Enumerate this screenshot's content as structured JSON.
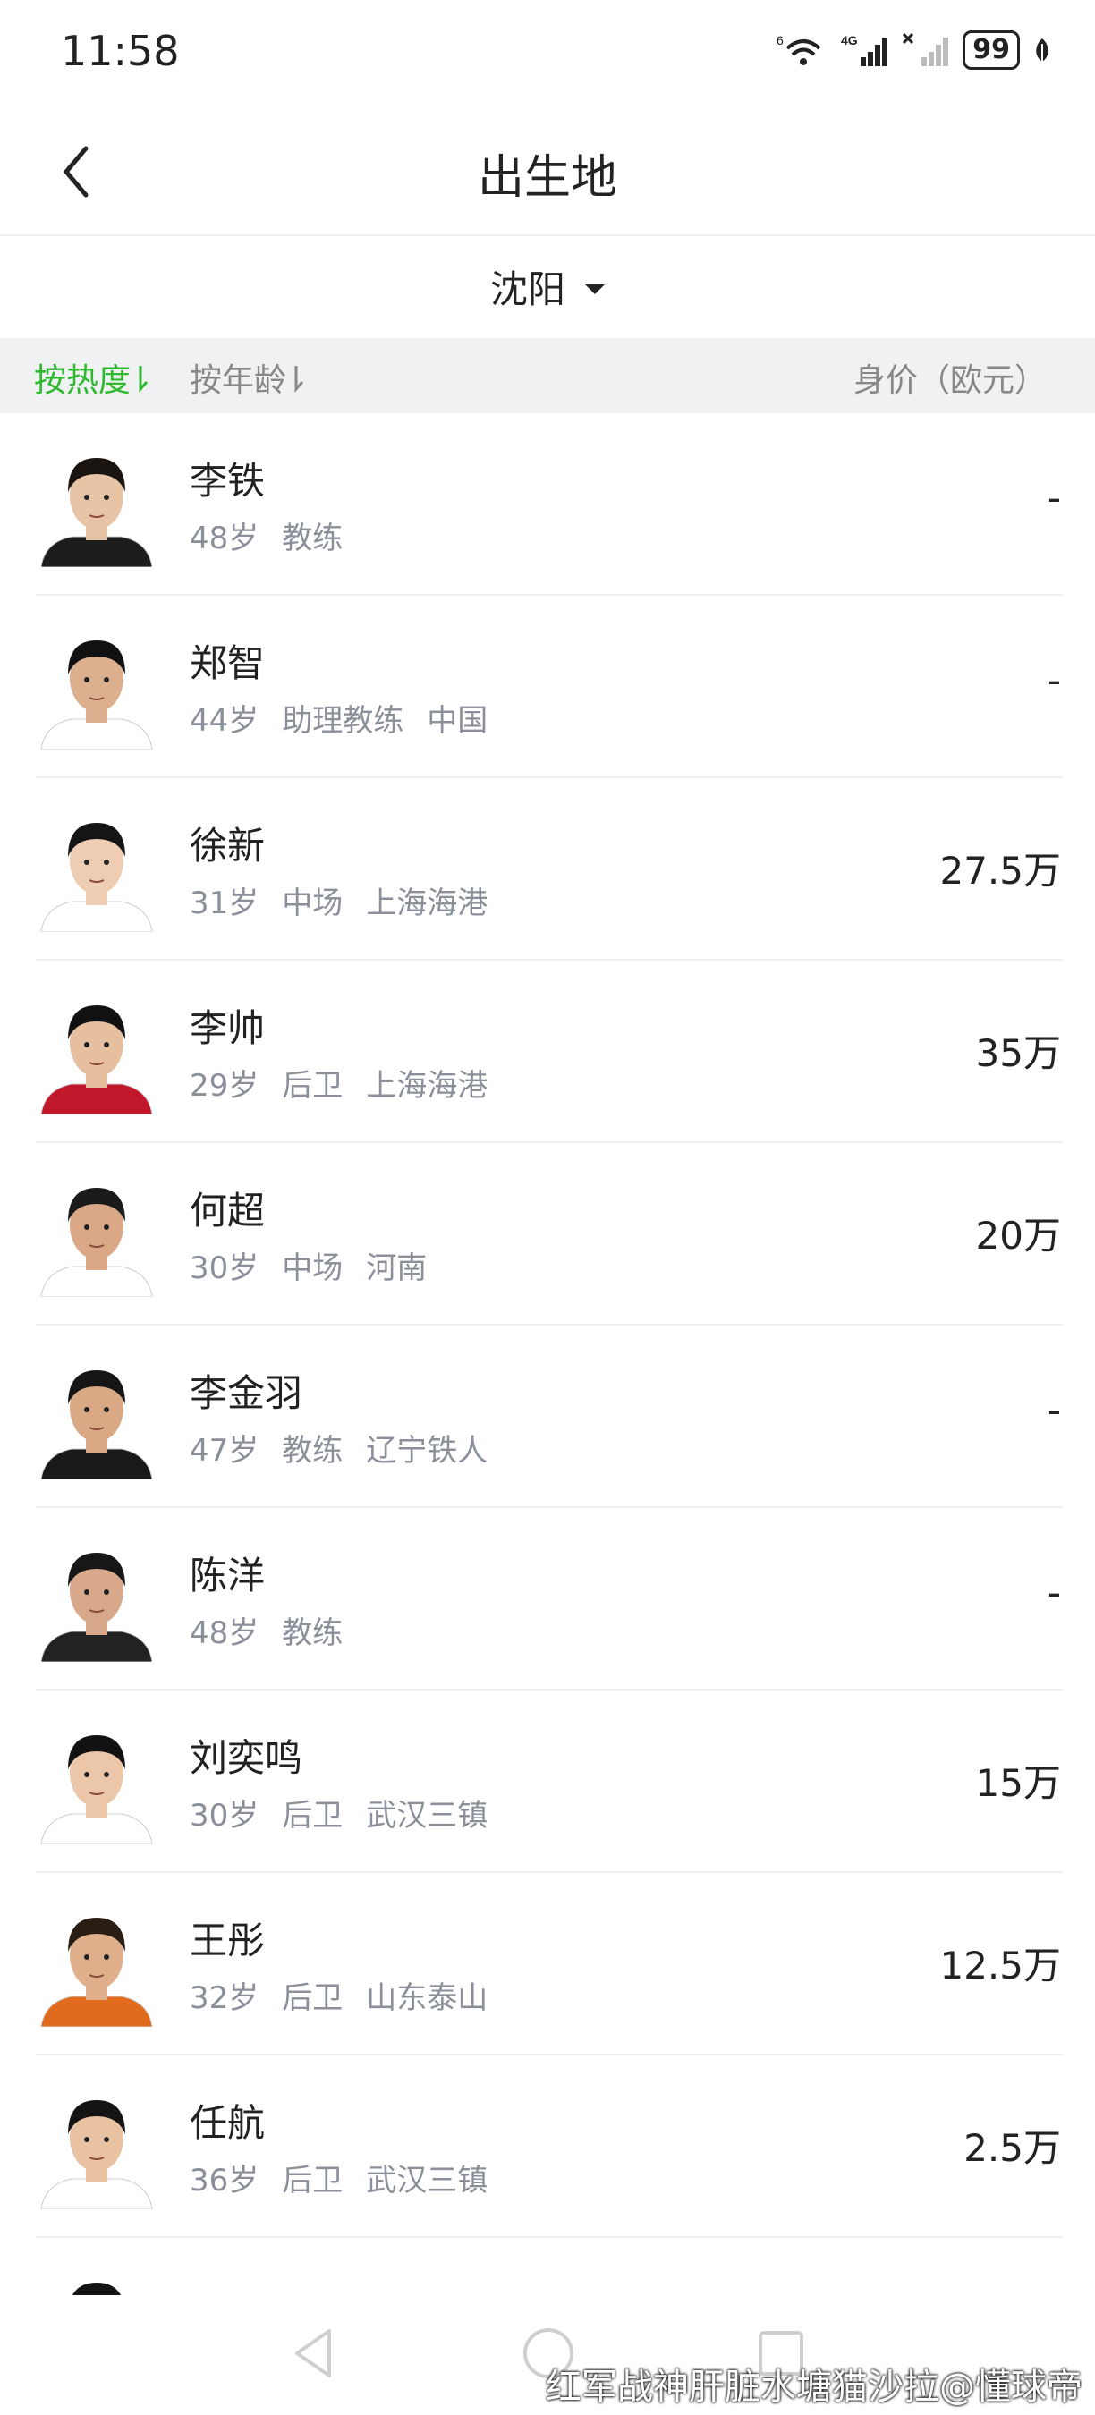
{
  "status_bar": {
    "time": "11:58",
    "battery": "99",
    "icons": [
      "wifi-icon",
      "signal-4g-icon",
      "signal-no-service-icon",
      "battery-icon",
      "leaf-icon"
    ]
  },
  "header": {
    "title": "出生地",
    "back_icon": "chevron-left-icon"
  },
  "filter": {
    "location": "沈阳",
    "dropdown_icon": "caret-down-icon"
  },
  "sort": {
    "by_heat": "按热度",
    "by_age": "按年龄",
    "price_header": "身价（欧元）",
    "active_color": "#2eb82e",
    "inactive_color": "#888888"
  },
  "players": [
    {
      "name": "李铁",
      "age": "48岁",
      "role": "教练",
      "team": "",
      "value": "-",
      "shirt": "#1d1d1d",
      "hair": "#1a1410",
      "skin": "#e8c4a6"
    },
    {
      "name": "郑智",
      "age": "44岁",
      "role": "助理教练",
      "team": "中国",
      "value": "-",
      "shirt": "#ffffff",
      "hair": "#111111",
      "skin": "#dcb08f"
    },
    {
      "name": "徐新",
      "age": "31岁",
      "role": "中场",
      "team": "上海海港",
      "value": "27.5万",
      "shirt": "#ffffff",
      "hair": "#151515",
      "skin": "#efcdb2"
    },
    {
      "name": "李帅",
      "age": "29岁",
      "role": "后卫",
      "team": "上海海港",
      "value": "35万",
      "shirt": "#c0182a",
      "hair": "#111111",
      "skin": "#e6bf9f"
    },
    {
      "name": "何超",
      "age": "30岁",
      "role": "中场",
      "team": "河南",
      "value": "20万",
      "shirt": "#ffffff",
      "hair": "#1b1b1b",
      "skin": "#dba887"
    },
    {
      "name": "李金羽",
      "age": "47岁",
      "role": "教练",
      "team": "辽宁铁人",
      "value": "-",
      "shirt": "#1a1a1a",
      "hair": "#161616",
      "skin": "#d9a884"
    },
    {
      "name": "陈洋",
      "age": "48岁",
      "role": "教练",
      "team": "",
      "value": "-",
      "shirt": "#222222",
      "hair": "#171717",
      "skin": "#d7a98a"
    },
    {
      "name": "刘奕鸣",
      "age": "30岁",
      "role": "后卫",
      "team": "武汉三镇",
      "value": "15万",
      "shirt": "#ffffff",
      "hair": "#121212",
      "skin": "#ecc6a9"
    },
    {
      "name": "王彤",
      "age": "32岁",
      "role": "后卫",
      "team": "山东泰山",
      "value": "12.5万",
      "shirt": "#e26a1c",
      "hair": "#2a1d14",
      "skin": "#e0b08d"
    },
    {
      "name": "任航",
      "age": "36岁",
      "role": "后卫",
      "team": "武汉三镇",
      "value": "2.5万",
      "shirt": "#ffffff",
      "hair": "#141414",
      "skin": "#e9c2a2"
    },
    {
      "name": "",
      "age": "",
      "role": "",
      "team": "",
      "value": "",
      "shirt": "#ffffff",
      "hair": "#141414",
      "skin": "#e2b896"
    }
  ],
  "nav": {
    "back": "back-triangle-icon",
    "home": "home-circle-icon",
    "recents": "recents-square-icon"
  },
  "watermark": "红军战神肝脏水塘猫沙拉@懂球帝"
}
